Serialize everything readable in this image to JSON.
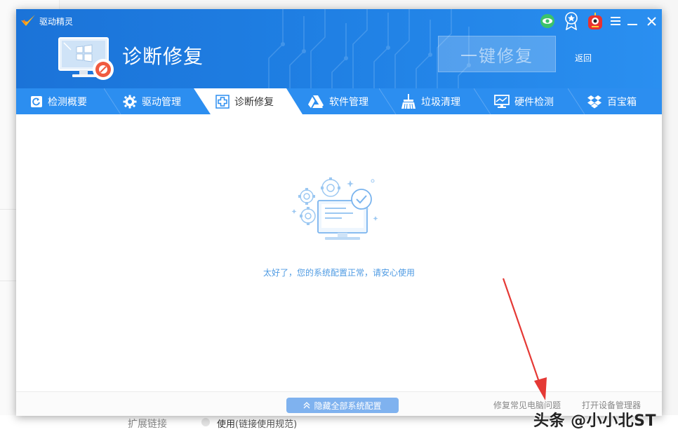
{
  "background": {
    "extension_label": "扩展链接",
    "use_label": "使用",
    "use_note": "(链接使用规范)"
  },
  "watermark": "头条 @小小北ST",
  "app": {
    "name": "驱动精灵"
  },
  "header": {
    "title": "诊断修复",
    "repair_button": "一键修复",
    "back_label": "返回"
  },
  "tabs": [
    {
      "label": "检测概要",
      "icon": "refresh-doc-icon"
    },
    {
      "label": "驱动管理",
      "icon": "gear-icon"
    },
    {
      "label": "诊断修复",
      "icon": "medical-cross-icon",
      "active": true
    },
    {
      "label": "软件管理",
      "icon": "triangle-logo-icon"
    },
    {
      "label": "垃圾清理",
      "icon": "broom-icon"
    },
    {
      "label": "硬件检测",
      "icon": "monitor-icon"
    },
    {
      "label": "百宝箱",
      "icon": "dropbox-icon"
    }
  ],
  "content": {
    "status_message": "太好了，您的系统配置正常，请安心使用"
  },
  "footer": {
    "hide_button": "隐藏全部系统配置",
    "fix_common_link": "修复常见电脑问题",
    "open_device_manager_link": "打开设备管理器"
  },
  "colors": {
    "header_blue": "#1f7fe3",
    "tab_bar_blue": "#2c8ef0",
    "status_text_blue": "#4f9be3",
    "annotation_red": "#e53935"
  }
}
